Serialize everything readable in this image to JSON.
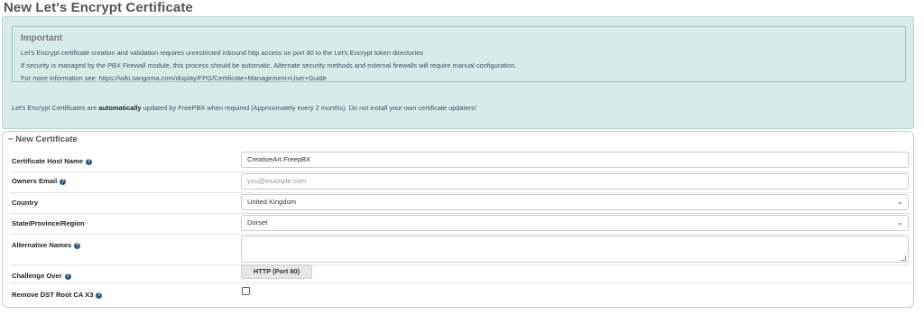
{
  "page": {
    "title": "New Let's Encrypt Certificate"
  },
  "alert": {
    "heading": "Important",
    "lines": [
      "Let's Encrypt certificate creation and validation requires unrestricted inbound http access on port 80 to the Let's Encrypt token directories",
      "If security is managed by the PBX Firewall module, this process should be automatic. Alternate security methods and external firewalls will require manual configuration.",
      "For more information see: https://wiki.sangoma.com/display/FPG/Certificate+Management+User+Guide"
    ],
    "footer_prefix": "Let's Encrypt Certificates are ",
    "footer_bold": "automatically",
    "footer_suffix": " updated by FreePBX when required (Approximately every 2 months). Do not install your own certificate updaters!"
  },
  "section": {
    "toggle": "−",
    "title": "New Certificate"
  },
  "fields": {
    "host_name": {
      "label": "Certificate Host Name",
      "value": "CreativeArt.FreepBX"
    },
    "owners_email": {
      "label": "Owners Email",
      "placeholder": "you@example.com"
    },
    "country": {
      "label": "Country",
      "selected": "United Kingdom"
    },
    "state": {
      "label": "State/Province/Region",
      "selected": "Dorset"
    },
    "alt_names": {
      "label": "Alternative Names",
      "value": ""
    },
    "challenge": {
      "label": "Challenge Over",
      "option": "HTTP (Port 80)"
    },
    "remove_dst": {
      "label": "Remove DST Root CA X3",
      "checked": false
    }
  },
  "icons": {
    "help": "question-circle-icon",
    "chevron": "chevron-down-icon"
  },
  "colors": {
    "alert_bg": "#d7ece9",
    "help_icon": "#2e5c87"
  }
}
